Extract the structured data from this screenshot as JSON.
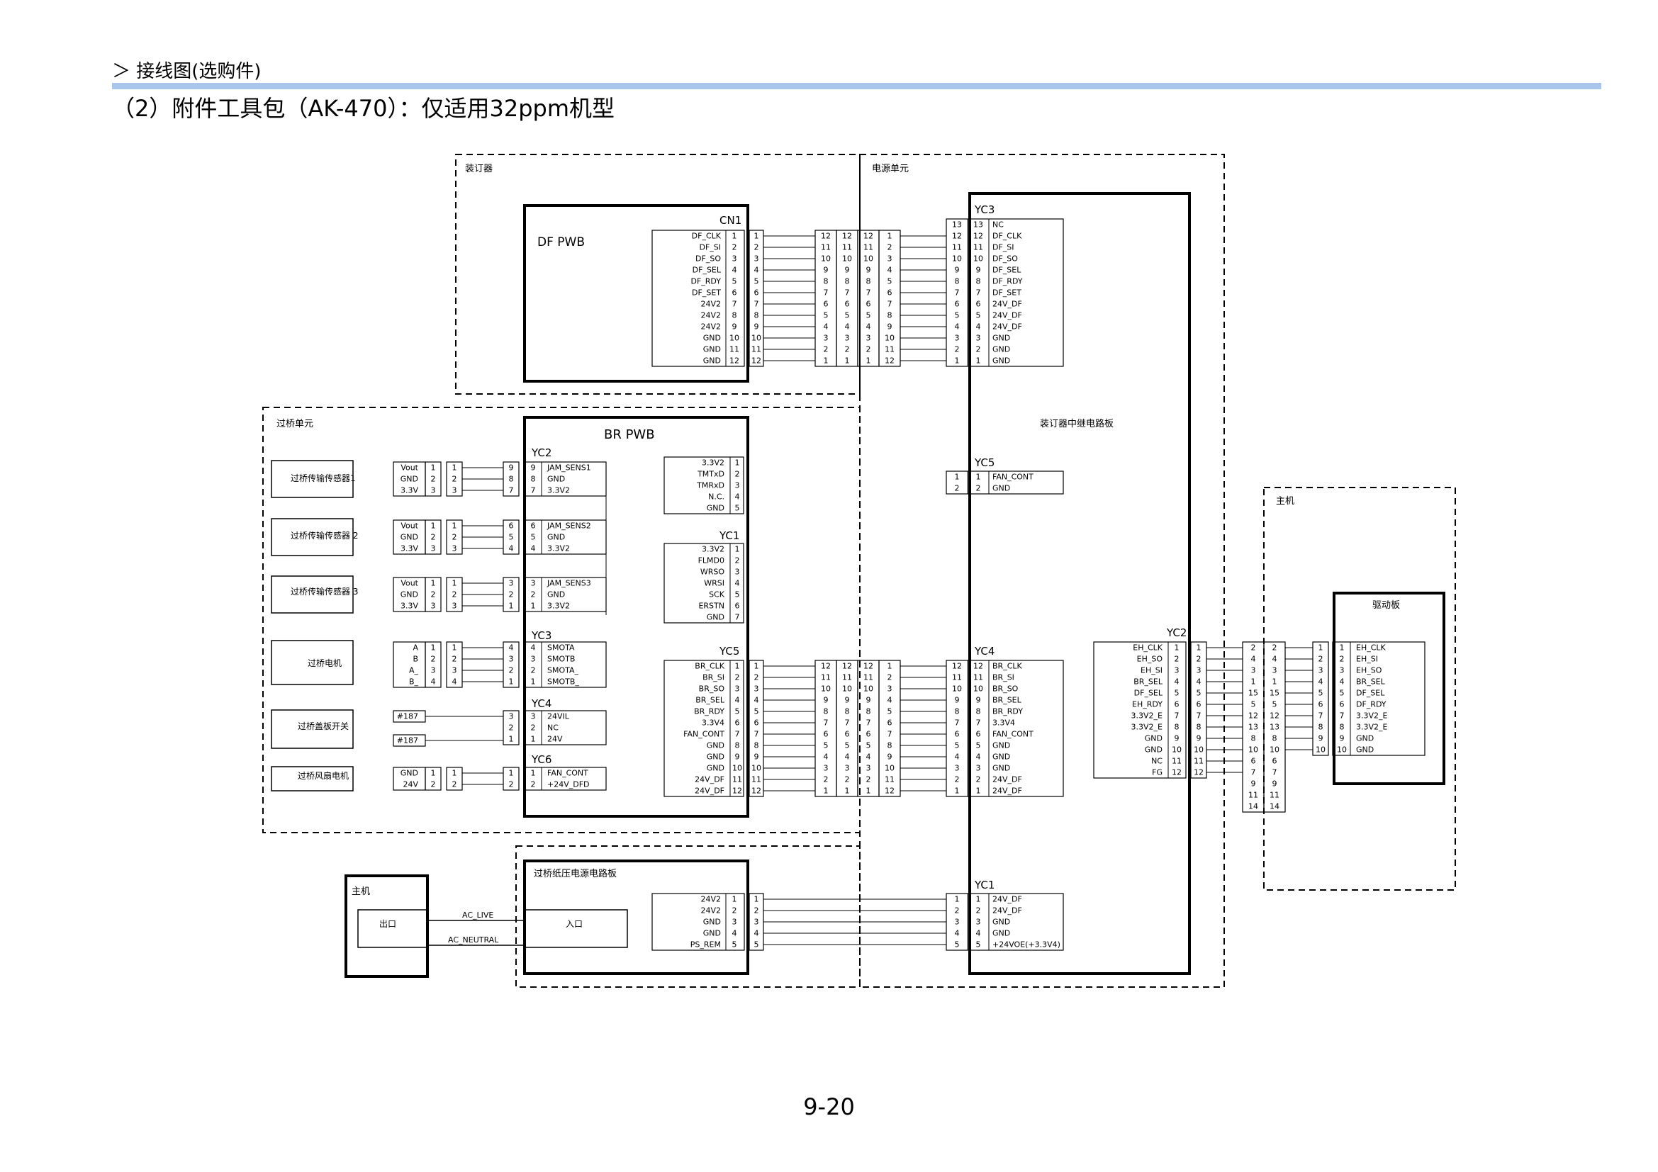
{
  "header": {
    "breadcrumb": "＞ 接线图(选购件)",
    "title": "（2）附件工具包（AK-470）：仅适用32ppm机型",
    "page_number": "9-20"
  },
  "units": {
    "stapler": "装订器",
    "power_unit": "电源单元",
    "bridge_unit": "过桥单元",
    "main_unit": "主机"
  },
  "boards": {
    "df_pwb": "DF PWB",
    "br_pwb": "BR PWB",
    "relay": "装订器中继电路板",
    "drive": "驱动板",
    "bridge_psu": "过桥纸压电源电路板",
    "main_left": "主机",
    "outlet": "出口",
    "inlet": "入口",
    "ac_live": "AC_LIVE",
    "ac_neutral": "AC_NEUTRAL"
  },
  "connectors": {
    "cn1": "CN1",
    "yc2": "YC2",
    "yc3": "YC3",
    "yc4": "YC4",
    "yc6": "YC6",
    "yc1": "YC1",
    "yc5": "YC5",
    "r_yc3": "YC3",
    "r_yc5": "YC5",
    "r_yc4": "YC4",
    "r_yc1": "YC1",
    "r_yc2": "YC2"
  },
  "devices": {
    "sensor1": "过桥传输传感器1",
    "sensor2": "过桥传输传感器 2",
    "sensor3": "过桥传输传感器 3",
    "motor": "过桥电机",
    "cover_switch": "过桥盖板开关",
    "fan": "过桥风扇电机"
  },
  "signals": {
    "cn1_sig": [
      "DF_CLK",
      "DF_SI",
      "DF_SO",
      "DF_SEL",
      "DF_RDY",
      "DF_SET",
      "24V2",
      "24V2",
      "24V2",
      "GND",
      "GND",
      "GND"
    ],
    "cn1_pin": [
      "1",
      "2",
      "3",
      "4",
      "5",
      "6",
      "7",
      "8",
      "9",
      "10",
      "11",
      "12"
    ],
    "cn1_pin2": [
      "1",
      "2",
      "3",
      "4",
      "5",
      "6",
      "7",
      "8",
      "9",
      "10",
      "11",
      "12"
    ],
    "cn1_r1": [
      "12",
      "11",
      "10",
      "9",
      "8",
      "7",
      "6",
      "5",
      "4",
      "3",
      "2",
      "1"
    ],
    "cn1_r2": [
      "12",
      "11",
      "10",
      "9",
      "8",
      "7",
      "6",
      "5",
      "4",
      "3",
      "2",
      "1"
    ],
    "cn1_r3": [
      "12",
      "11",
      "10",
      "9",
      "8",
      "7",
      "6",
      "5",
      "4",
      "3",
      "2",
      "1"
    ],
    "cn1_r4": [
      "1",
      "2",
      "3",
      "4",
      "5",
      "6",
      "7",
      "8",
      "9",
      "10",
      "11",
      "12"
    ],
    "r_yc3_pin1": [
      "13",
      "12",
      "11",
      "10",
      "9",
      "8",
      "7",
      "6",
      "5",
      "4",
      "3",
      "2",
      "1"
    ],
    "r_yc3_pin2": [
      "13",
      "12",
      "11",
      "10",
      "9",
      "8",
      "7",
      "6",
      "5",
      "4",
      "3",
      "2",
      "1"
    ],
    "r_yc3_sig": [
      "NC",
      "DF_CLK",
      "DF_SI",
      "DF_SO",
      "DF_SEL",
      "DF_RDY",
      "DF_SET",
      "24V_DF",
      "24V_DF",
      "24V_DF",
      "GND",
      "GND",
      "GND"
    ],
    "r_yc5_pin": [
      "1",
      "2"
    ],
    "r_yc5_sig": [
      "FAN_CONT",
      "GND"
    ],
    "s_pins_a": [
      "1",
      "2",
      "3"
    ],
    "s_pins_b": [
      "1",
      "2",
      "3"
    ],
    "s_sig": [
      "Vout",
      "GND",
      "3.3V"
    ],
    "yc2_g1_l": [
      "9",
      "8",
      "7"
    ],
    "yc2_g2_l": [
      "6",
      "5",
      "4"
    ],
    "yc2_g3_l": [
      "3",
      "2",
      "1"
    ],
    "yc2_g1_sig": [
      "JAM_SENS1",
      "GND",
      "3.3V2"
    ],
    "yc2_g2_sig": [
      "JAM_SENS2",
      "GND",
      "3.3V2"
    ],
    "yc2_g3_sig": [
      "JAM_SENS3",
      "GND",
      "3.3V2"
    ],
    "motor_sig": [
      "A",
      "B",
      "A_",
      "B_"
    ],
    "motor_pin": [
      "1",
      "2",
      "3",
      "4"
    ],
    "yc3_l": [
      "4",
      "3",
      "2",
      "1"
    ],
    "yc3_sig": [
      "SMOTA",
      "SMOTB",
      "SMOTA_",
      "SMOTB_"
    ],
    "switch_sig": [
      "#187",
      "#187"
    ],
    "yc4_l": [
      "3",
      "2",
      "1"
    ],
    "yc4_sig": [
      "24VIL",
      "NC",
      "24V"
    ],
    "fan_sig": [
      "GND",
      "24V"
    ],
    "fan_pin": [
      "1",
      "2"
    ],
    "yc6_l": [
      "1",
      "2"
    ],
    "yc6_sig": [
      "FAN_CONT",
      "+24V_DFD"
    ],
    "top_sig": [
      "3.3V2",
      "TMTxD",
      "TMRxD",
      "N.C.",
      "GND"
    ],
    "top_pin": [
      "1",
      "2",
      "3",
      "4",
      "5"
    ],
    "yc1_sig": [
      "3.3V2",
      "FLMD0",
      "WRSO",
      "WRSI",
      "SCK",
      "ERSTN",
      "GND"
    ],
    "yc1_pin": [
      "1",
      "2",
      "3",
      "4",
      "5",
      "6",
      "7"
    ],
    "yc5_sig": [
      "BR_CLK",
      "BR_SI",
      "BR_SO",
      "BR_SEL",
      "BR_RDY",
      "3.3V4",
      "FAN_CONT",
      "GND",
      "GND",
      "GND",
      "24V_DF",
      "24V_DF"
    ],
    "yc5_pin": [
      "1",
      "2",
      "3",
      "4",
      "5",
      "6",
      "7",
      "8",
      "9",
      "10",
      "11",
      "12"
    ],
    "r_yc4_sig": [
      "BR_CLK",
      "BR_SI",
      "BR_SO",
      "BR_SEL",
      "BR_RDY",
      "3.3V4",
      "FAN_CONT",
      "GND",
      "GND",
      "GND",
      "24V_DF",
      "24V_DF"
    ],
    "psu_sig": [
      "24V2",
      "24V2",
      "GND",
      "GND",
      "PS_REM"
    ],
    "psu_pin": [
      "1",
      "2",
      "3",
      "4",
      "5"
    ],
    "r_yc1_sig": [
      "24V_DF",
      "24V_DF",
      "GND",
      "GND",
      "+24VOE(+3.3V4)"
    ],
    "yc2r_sig": [
      "EH_CLK",
      "EH_SO",
      "EH_SI",
      "BR_SEL",
      "DF_SEL",
      "EH_RDY",
      "3.3V2_E",
      "3.3V2_E",
      "GND",
      "GND",
      "NC",
      "FG"
    ],
    "yc2r_pin": [
      "1",
      "2",
      "3",
      "4",
      "5",
      "6",
      "7",
      "8",
      "9",
      "10",
      "11",
      "12"
    ],
    "h_pin": [
      "2",
      "4",
      "3",
      "1",
      "15",
      "5",
      "12",
      "13",
      "8",
      "10",
      "6",
      "7",
      "9",
      "11",
      "14"
    ],
    "drv_pin": [
      "1",
      "2",
      "3",
      "4",
      "5",
      "6",
      "7",
      "8",
      "9",
      "10"
    ],
    "drv_sig": [
      "EH_CLK",
      "EH_SI",
      "EH_SO",
      "BR_SEL",
      "DF_SEL",
      "DF_RDY",
      "3.3V2_E",
      "3.3V2_E",
      "GND",
      "GND"
    ]
  }
}
